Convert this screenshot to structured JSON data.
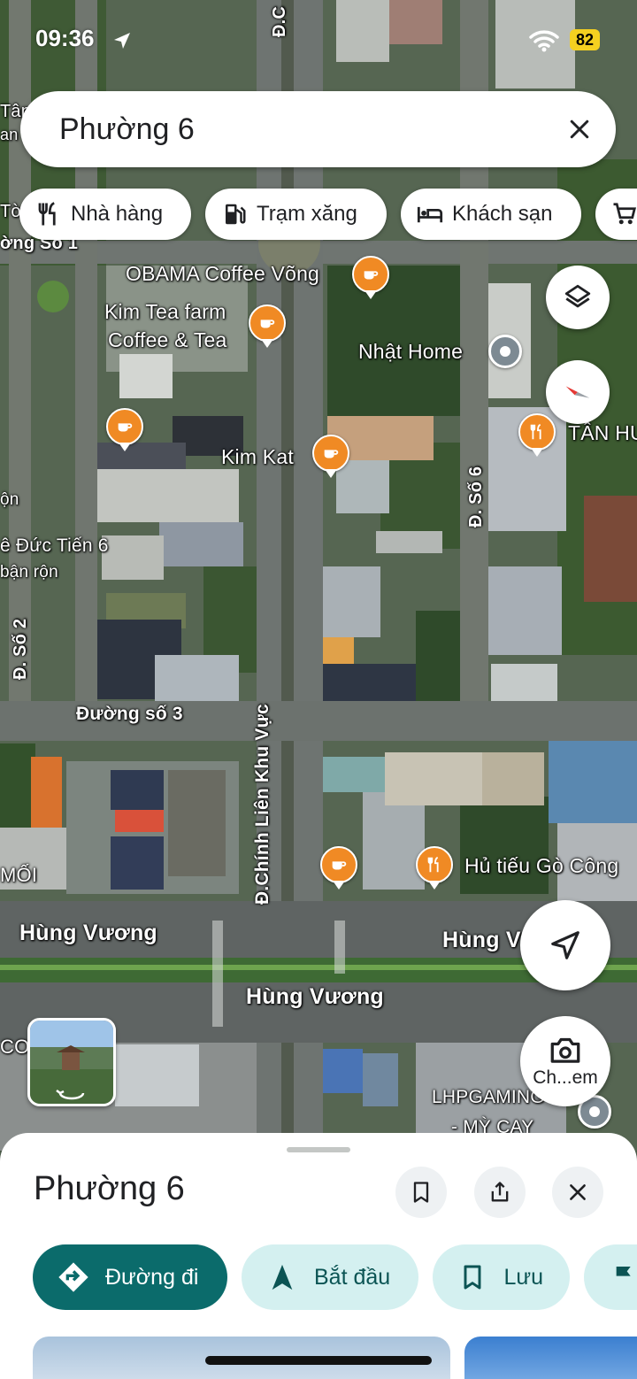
{
  "status_bar": {
    "time": "09:36",
    "battery": "82"
  },
  "search": {
    "query": "Phường 6"
  },
  "chips": [
    {
      "label": "Nhà hàng",
      "icon": "fork-knife-icon"
    },
    {
      "label": "Trạm xăng",
      "icon": "gas-station-icon"
    },
    {
      "label": "Khách sạn",
      "icon": "bed-icon"
    },
    {
      "label": "",
      "icon": "shopping-cart-icon"
    }
  ],
  "map": {
    "places": [
      {
        "name": "OBAMA Coffee Võng",
        "type": "cafe"
      },
      {
        "name": "Kim Tea farm",
        "type": "cafe"
      },
      {
        "name": "Coffee & Tea",
        "type": "cafe"
      },
      {
        "name": "Kim Kat",
        "type": "cafe"
      },
      {
        "name": "Nhật Home",
        "type": "lodging"
      },
      {
        "name": "TÂN HU",
        "type": "restaurant"
      },
      {
        "name": "Hủ tiếu Gò Công",
        "type": "restaurant"
      },
      {
        "name": "LHPGAMING",
        "type": "place"
      },
      {
        "name": "- MỲ CAY",
        "type": "place"
      }
    ],
    "streets": [
      {
        "name": "Đường số 3"
      },
      {
        "name": "Đ.Chính Liên Khu Vực"
      },
      {
        "name": "Đ. Số 6"
      },
      {
        "name": "Đ. Số 2"
      },
      {
        "name": "Hùng Vương"
      },
      {
        "name": "Hùng Vương"
      },
      {
        "name": "Hùng V"
      },
      {
        "name": "Đ.C"
      },
      {
        "name": "ờng Số 1"
      }
    ],
    "edge_labels": [
      "Tân",
      "an n",
      "Tờ",
      "ộn",
      "ê Đức Tiến 6",
      "bận rộn",
      "MỐI",
      "CO",
      "ờ"
    ],
    "camera_label": "Ch...em"
  },
  "sheet": {
    "title": "Phường 6",
    "actions": [
      {
        "label": "Đường đi",
        "icon": "directions-icon",
        "style": "primary"
      },
      {
        "label": "Bắt đầu",
        "icon": "navigation-arrow-icon",
        "style": "secondary"
      },
      {
        "label": "Lưu",
        "icon": "bookmark-icon",
        "style": "secondary"
      },
      {
        "label": "",
        "icon": "flag-icon",
        "style": "secondary"
      }
    ]
  },
  "colors": {
    "accent_teal": "#0b6b6b",
    "chip_secondary": "#d4f0f0",
    "poi_orange": "#f08a24"
  }
}
